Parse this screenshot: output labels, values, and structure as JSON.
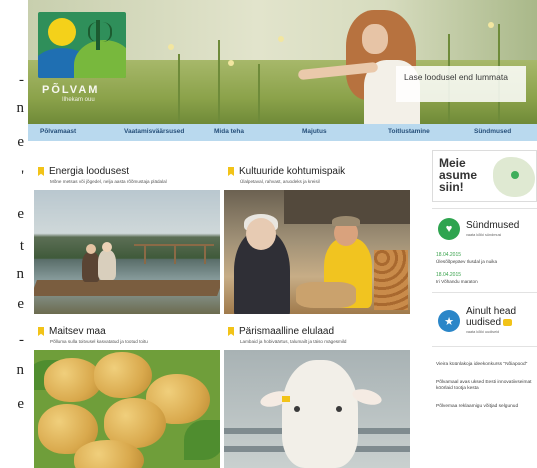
{
  "left_strip": {
    "letters": [
      "-",
      "n",
      "e",
      "'",
      "e",
      "t",
      "n",
      "e",
      "-",
      "n",
      "e"
    ]
  },
  "logo": {
    "name": "PÕLVAM",
    "tagline": "Ilhekam ouu"
  },
  "hero": {
    "quote": "Lase loodusel end lummata"
  },
  "nav": {
    "items": [
      "Põlvamaast",
      "Vaatamisväärsused",
      "Mida teha",
      "Majutus",
      "Toitlustamine",
      "Sündmused"
    ]
  },
  "tiles": [
    {
      "title": "Energia loodusest",
      "subtitle": "Mõne metsas või jõgedel, nelja aasta rõõmustaja plädalal"
    },
    {
      "title": "Kultuuride kohtumispaik",
      "subtitle": "Ülalpetaval, rahvast, aruodeks ja kreisil"
    },
    {
      "title": "Maitsev maa",
      "subtitle": "Põlluma sulla toitvusel kasvatatud ja tootud toitu"
    },
    {
      "title": "Pärismaalline elulaad",
      "subtitle": "Lambaid ja hobiväärtus, talumailt ja täiso mägesmild"
    }
  ],
  "sidebar": {
    "map_text": [
      "Meie",
      "asume",
      "siin!"
    ],
    "events": {
      "heading": "Sündmused",
      "sub": "vaata kõiki sündmusi",
      "items": [
        {
          "date": "18.04.2015",
          "text": "Ülesõõpepäev Ilusdal ja nuika"
        },
        {
          "date": "18.04.2015",
          "text": "Iri Võhandu maraton"
        }
      ]
    },
    "news": {
      "heading_line1": "Ainult head",
      "heading_line2": "uudised",
      "sub": "vaata kõiki uudiseid",
      "items": [
        "Vieira küünlakoja ideekonkurss \"Nõiapood\"",
        "Põlvamaal avas uksed Eesti innovatiivseimat köörlaid tootja kesta",
        "Põlvemaa reklaamigu võitjad selgunud"
      ]
    }
  },
  "colors": {
    "nav_bg": "#b9d9ee",
    "nav_text": "#27507a",
    "accent_yellow": "#f2c318",
    "event_green": "#2ea44f",
    "news_blue": "#2b86c8"
  }
}
